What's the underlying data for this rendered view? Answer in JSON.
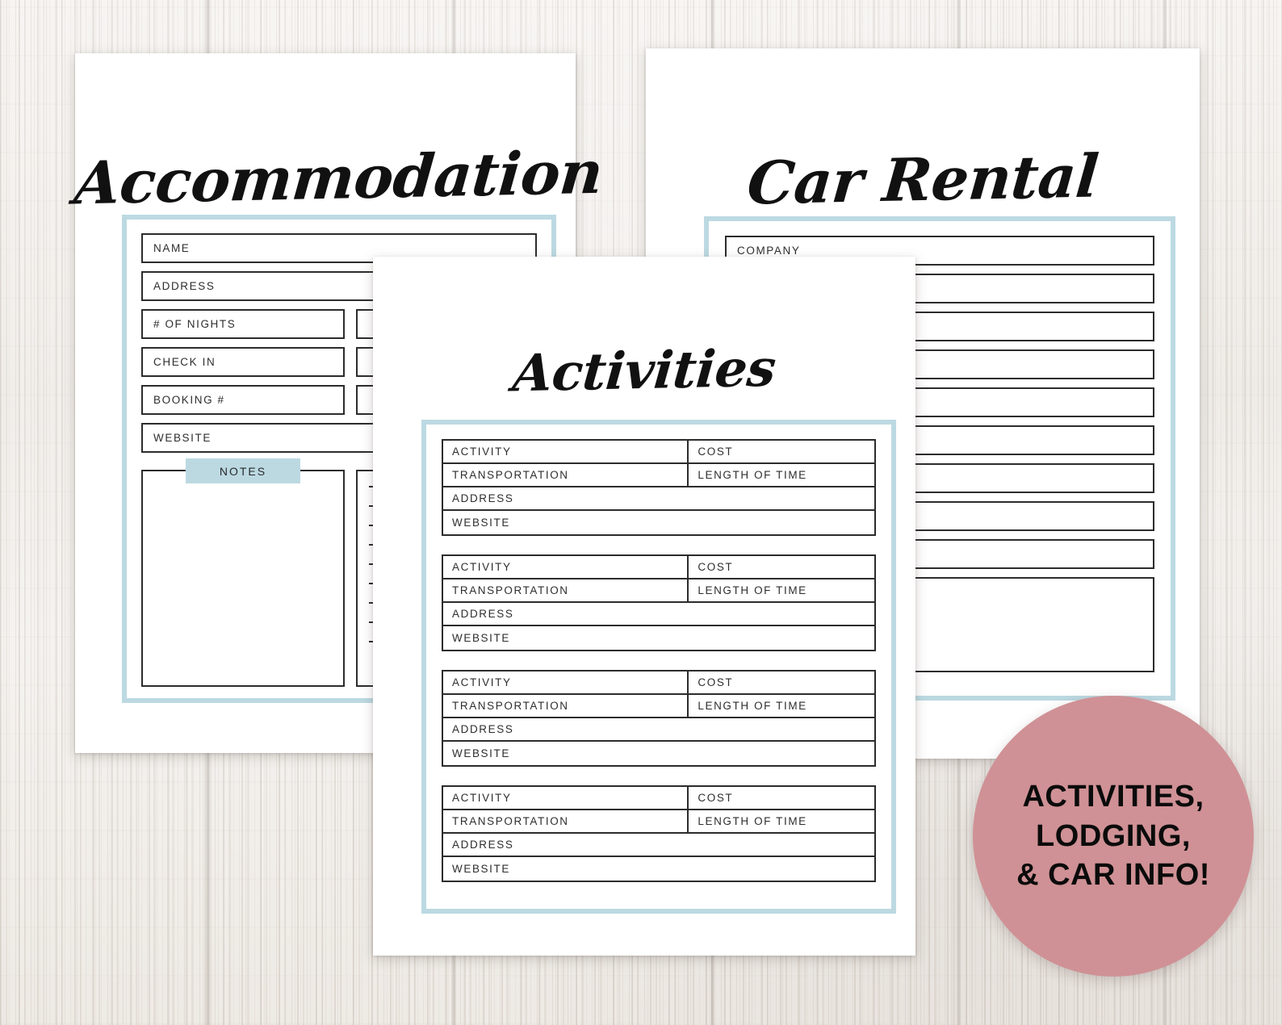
{
  "background": {
    "texture": "whitewashed-wood-planks",
    "base_color": "#f0ece7"
  },
  "theme": {
    "frame_blue": "#bcd9e2",
    "badge_pink": "#cf9195",
    "ink": "#2c2c2c",
    "paper": "#ffffff"
  },
  "pages": {
    "accommodation": {
      "title": "Accommodation",
      "fields": [
        {
          "label": "NAME",
          "span": "full"
        },
        {
          "label": "ADDRESS",
          "span": "full"
        },
        {
          "label": "# OF NIGHTS",
          "span": "left"
        },
        {
          "label": "CHECK IN",
          "span": "left"
        },
        {
          "label": "BOOKING #",
          "span": "left"
        },
        {
          "label": "WEBSITE",
          "span": "full"
        }
      ],
      "right_fields": [
        {
          "label": ""
        },
        {
          "label": ""
        },
        {
          "label": ""
        }
      ],
      "notes_label": "NOTES",
      "checklist_lines": 9
    },
    "car_rental": {
      "title": "Car Rental",
      "fields": [
        {
          "label": "COMPANY"
        },
        {
          "label": ""
        },
        {
          "label": ""
        },
        {
          "label": ""
        },
        {
          "label": ""
        },
        {
          "label": ""
        },
        {
          "label": ""
        },
        {
          "label": ""
        },
        {
          "label": ""
        }
      ],
      "notes_box": {
        "label": ""
      }
    },
    "activities": {
      "title": "Activities",
      "entry_count": 4,
      "entry_template": {
        "row1": {
          "left": "ACTIVITY",
          "right": "COST"
        },
        "row2": {
          "left": "TRANSPORTATION",
          "right": "LENGTH OF TIME"
        },
        "row3": {
          "full": "ADDRESS"
        },
        "row4": {
          "full": "WEBSITE"
        }
      },
      "entries": [
        {
          "activity": "ACTIVITY",
          "cost": "COST",
          "transportation": "TRANSPORTATION",
          "length_of_time": "LENGTH OF TIME",
          "address": "ADDRESS",
          "website": "WEBSITE"
        },
        {
          "activity": "ACTIVITY",
          "cost": "COST",
          "transportation": "TRANSPORTATION",
          "length_of_time": "LENGTH OF TIME",
          "address": "ADDRESS",
          "website": "WEBSITE"
        },
        {
          "activity": "ACTIVITY",
          "cost": "COST",
          "transportation": "TRANSPORTATION",
          "length_of_time": "LENGTH OF TIME",
          "address": "ADDRESS",
          "website": "WEBSITE"
        },
        {
          "activity": "ACTIVITY",
          "cost": "COST",
          "transportation": "TRANSPORTATION",
          "length_of_time": "LENGTH OF TIME",
          "address": "ADDRESS",
          "website": "WEBSITE"
        }
      ]
    }
  },
  "badge": {
    "lines": [
      "ACTIVITIES,",
      "LODGING,",
      "& CAR INFO!"
    ],
    "color": "#cf9195"
  }
}
